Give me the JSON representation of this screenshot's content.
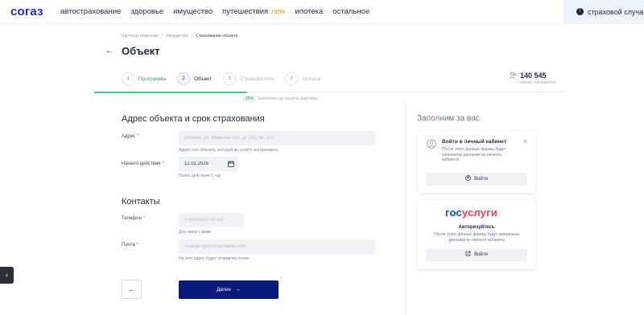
{
  "brand": {
    "logo": "согаз",
    "accent": "#1b2bc6",
    "button_color": "#0a1a7a"
  },
  "nav": {
    "items": [
      "автострахование",
      "здоровье",
      "имущество",
      "путешествия",
      "ипотека",
      "остальное"
    ],
    "new_badge": "new",
    "case_button": "страховой случа"
  },
  "breadcrumb": [
    "Частным клиентам",
    "Имущество",
    "Страхование объекта"
  ],
  "page_title": "Объект",
  "steps": [
    {
      "num": "1",
      "label": "Программа",
      "state": "done"
    },
    {
      "num": "2",
      "label": "Объект",
      "state": "active"
    },
    {
      "num": "3",
      "label": "Страхователь",
      "state": "pending"
    },
    {
      "num": "4",
      "label": "Оплата",
      "state": "pending"
    }
  ],
  "stats": {
    "count": "140 545",
    "subtitle": "сейчас оформляют"
  },
  "progress": {
    "percent": "25%",
    "text": "Заполнено до защиты квартиры"
  },
  "address_section": {
    "title": "Адрес объекта и срок страхования",
    "address_label": "Адрес",
    "address_placeholder": "Москва, ул. Иванова 101, д. 101, кв. 101",
    "address_hint": "Адрес того объекта, который вы хотите застраховать",
    "start_label": "Начало действия",
    "start_value": "12.01.2025",
    "start_hint": "Полис действует 1 год"
  },
  "contacts_section": {
    "title": "Контакты",
    "phone_label": "Телефон",
    "phone_placeholder": "+7(000)000-00-00",
    "phone_hint": "Для связи с вами",
    "email_label": "Почта",
    "email_placeholder": "example@domainname.com",
    "email_hint": "На этот адрес будет отправлен полис"
  },
  "buttons": {
    "back": "←",
    "next": "Далее",
    "next_arrow": "→"
  },
  "right": {
    "title": "Заполним за вас",
    "card1": {
      "heading": "Войти в личный кабинет",
      "text": "После этого данные формы будут заполнены данными из личного кабинета",
      "button": "Войти"
    },
    "card2": {
      "logo_part1": "гос",
      "logo_part2": "услуги",
      "heading": "Авторизуйтесь",
      "text": "После этого данные формы будут заполнены данными из личного кабинета",
      "button": "Войти"
    }
  }
}
